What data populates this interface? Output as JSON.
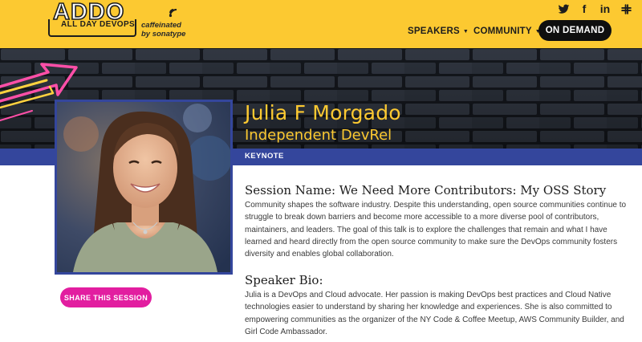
{
  "brand": {
    "logo_text": "ADDO",
    "logo_subtitle": "ALL DAY DEVOPS",
    "tagline_line1": "caffeinated",
    "tagline_line2": "by sonatype"
  },
  "social": [
    {
      "icon": "twitter-icon",
      "glyph": ""
    },
    {
      "icon": "facebook-icon",
      "glyph": "f"
    },
    {
      "icon": "linkedin-icon",
      "glyph": "in"
    },
    {
      "icon": "slack-icon",
      "glyph": ""
    }
  ],
  "nav": {
    "speakers": "SPEAKERS",
    "community": "COMMUNITY",
    "on_demand": "ON DEMAND"
  },
  "speaker": {
    "name": "Julia F Morgado",
    "title": "Independent DevRel",
    "track": "KEYNOTE"
  },
  "share_label": "SHARE THIS SESSION",
  "session": {
    "heading": "Session Name: We Need More Contributors: My OSS Story",
    "description": "Community shapes the software industry. Despite this understanding, open source communities continue to struggle to break down barriers and become more accessible to a more diverse pool of contributors, maintainers, and leaders. The goal of this talk is to explore the challenges that remain and what I have learned and heard directly from the open source community to make sure the DevOps community fosters diversity and enables global collaboration."
  },
  "bio": {
    "heading": "Speaker Bio:",
    "text": "Julia is a DevOps and Cloud advocate. Her passion is making DevOps best practices and Cloud Native technologies easier to understand by sharing her knowledge and experiences. She is also committed to empowering communities as the organizer of the NY Code & Coffee Meetup, AWS Community Builder, and Girl Code Ambassador."
  },
  "colors": {
    "header_yellow": "#fcc931",
    "keynote_blue": "#34469c",
    "share_pink": "#e21ea0",
    "on_demand_black": "#0f0f0f"
  }
}
